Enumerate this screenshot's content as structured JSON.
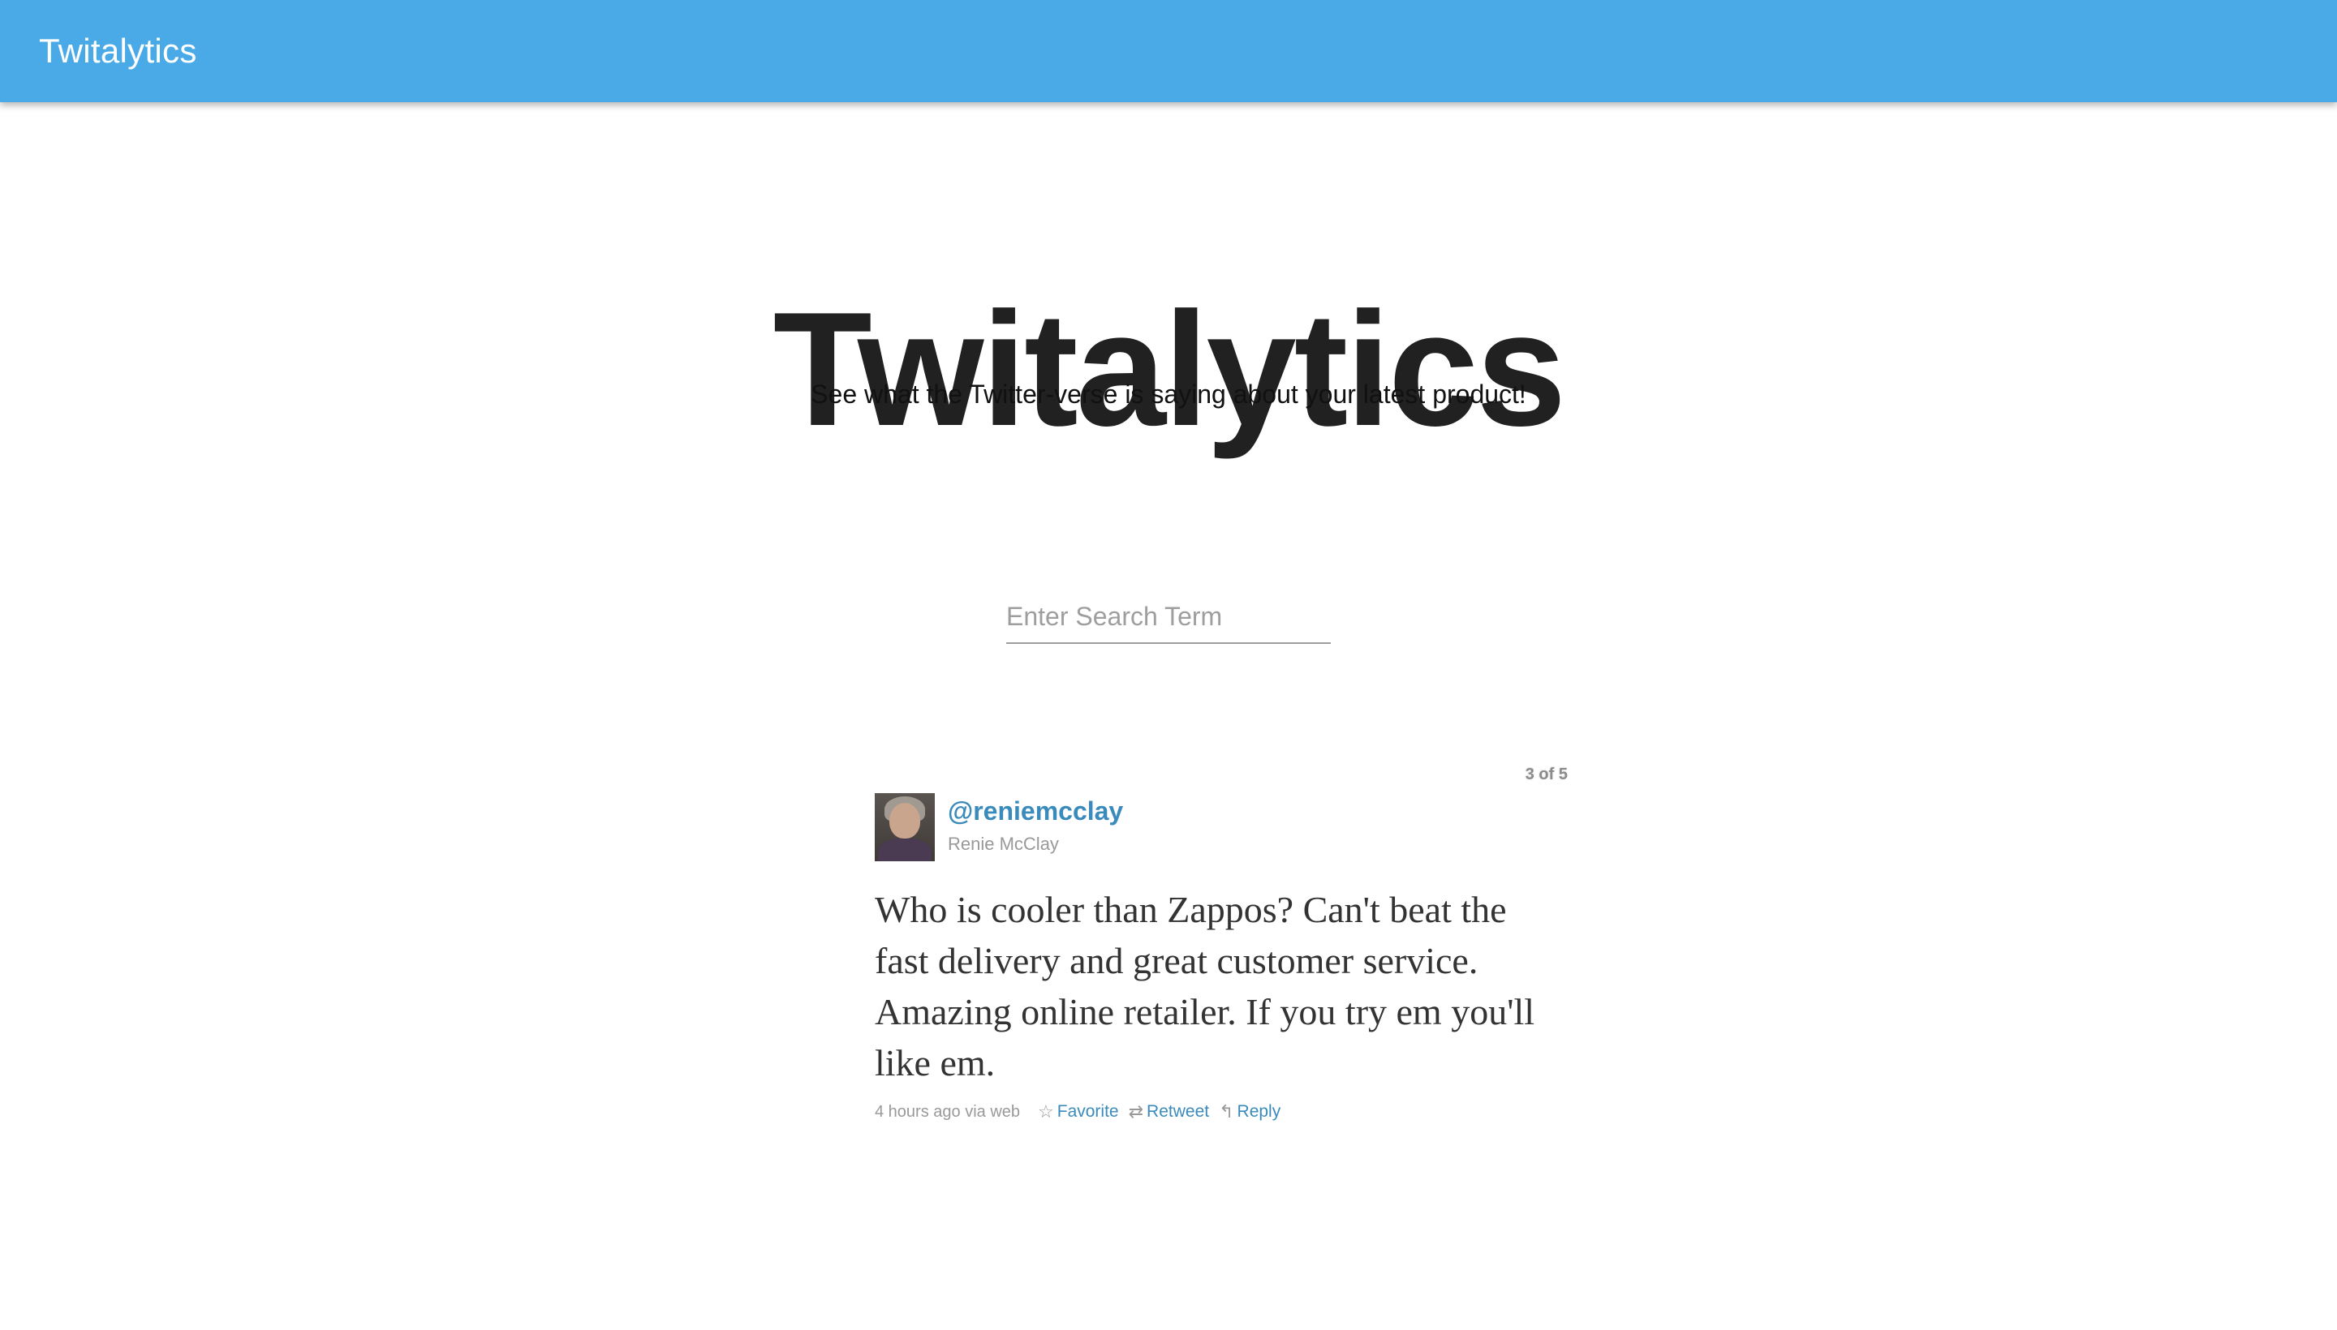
{
  "navbar": {
    "brand": "Twitalytics"
  },
  "hero": {
    "title": "Twitalytics",
    "subtitle": "See what the Twitter-verse is saying about your latest product!"
  },
  "search": {
    "placeholder": "Enter Search Term",
    "value": ""
  },
  "tweet": {
    "counter": "3 of 5",
    "handle": "@reniemcclay",
    "name": "Renie McClay",
    "text": "Who is cooler than Zappos? Can't beat the fast delivery and great customer service. Amazing online retailer. If you try em you'll like em.",
    "time": "4 hours ago via web",
    "actions": {
      "favorite": "Favorite",
      "retweet": "Retweet",
      "reply": "Reply"
    },
    "icons": {
      "favorite": "star-icon",
      "retweet": "retweet-icon",
      "reply": "reply-icon"
    }
  },
  "colors": {
    "navbar": "#4aaae7",
    "link": "#3a8bbb"
  }
}
